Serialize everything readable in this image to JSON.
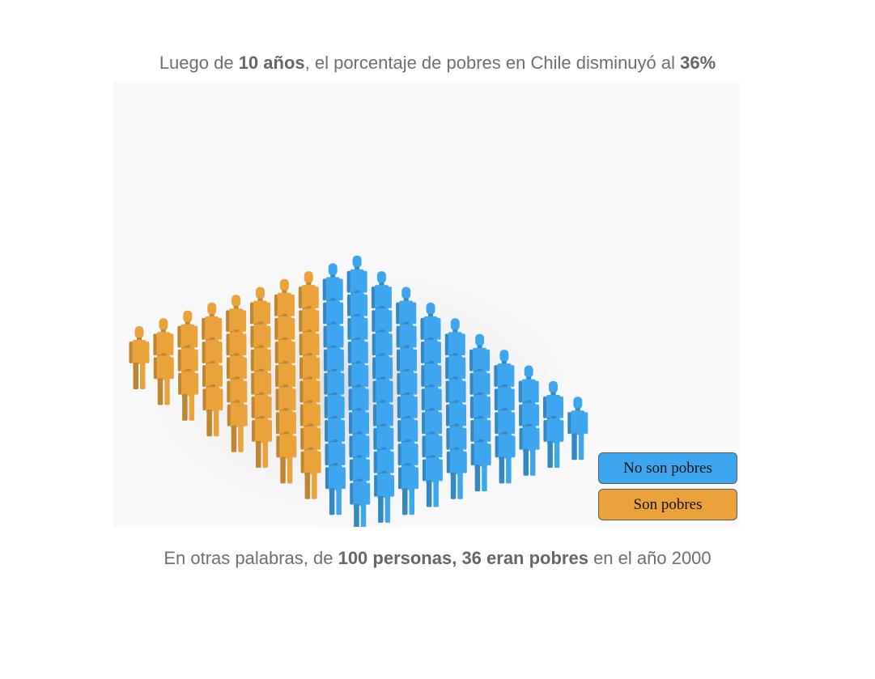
{
  "title": {
    "prefix": "Luego de ",
    "years": "10 años",
    "middle": ", el porcentaje de pobres en Chile disminuyó al ",
    "percent": "36%"
  },
  "caption": {
    "prefix": "En otras palabras, de ",
    "highlight": "100 personas, 36 eran pobres",
    "suffix": " en el año 2000"
  },
  "legend": {
    "not_poor": "No son pobres",
    "poor": "Son pobres"
  },
  "colors": {
    "not_poor": "#3ea6ee",
    "poor": "#eaa23b",
    "panel_bg": "#f9f9fa"
  },
  "chart_data": {
    "type": "pictogram",
    "total": 100,
    "categories": [
      "No son pobres",
      "Son pobres"
    ],
    "values": [
      64,
      36
    ],
    "unit": "personas",
    "year": 2000
  }
}
